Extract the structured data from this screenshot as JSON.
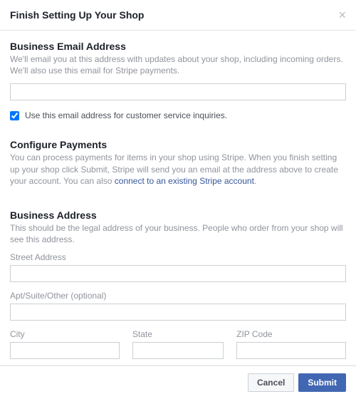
{
  "header": {
    "title": "Finish Setting Up Your Shop"
  },
  "email_section": {
    "heading": "Business Email Address",
    "desc": "We'll email you at this address with updates about your shop, including incoming orders. We'll also use this email for Stripe payments.",
    "input_value": "",
    "checkbox_label": "Use this email address for customer service inquiries."
  },
  "payments_section": {
    "heading": "Configure Payments",
    "desc_prefix": "You can process payments for items in your shop using Stripe. When you finish setting up your shop click Submit, Stripe will send you an email at the address above to create your account. You can also ",
    "link_text": "connect to an existing Stripe account",
    "desc_suffix": "."
  },
  "address_section": {
    "heading": "Business Address",
    "desc": "This should be the legal address of your business. People who order from your shop will see this address.",
    "street_label": "Street Address",
    "apt_label": "Apt/Suite/Other (optional)",
    "city_label": "City",
    "state_label": "State",
    "zip_label": "ZIP Code",
    "street_value": "",
    "apt_value": "",
    "city_value": "",
    "state_value": "",
    "zip_value": ""
  },
  "footer": {
    "cancel_label": "Cancel",
    "submit_label": "Submit"
  }
}
